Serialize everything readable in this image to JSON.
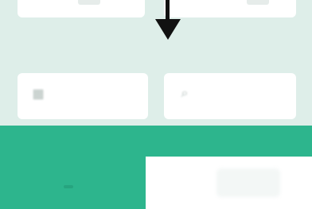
{
  "section": {
    "label": ""
  },
  "fields": [
    {
      "icon": "calendar-icon"
    },
    {
      "icon": "search-icon"
    }
  ],
  "cta": {
    "label": ""
  },
  "colors": {
    "panel_bg": "#deeee9",
    "accent": "#2db58d",
    "arrow": "#111111"
  }
}
